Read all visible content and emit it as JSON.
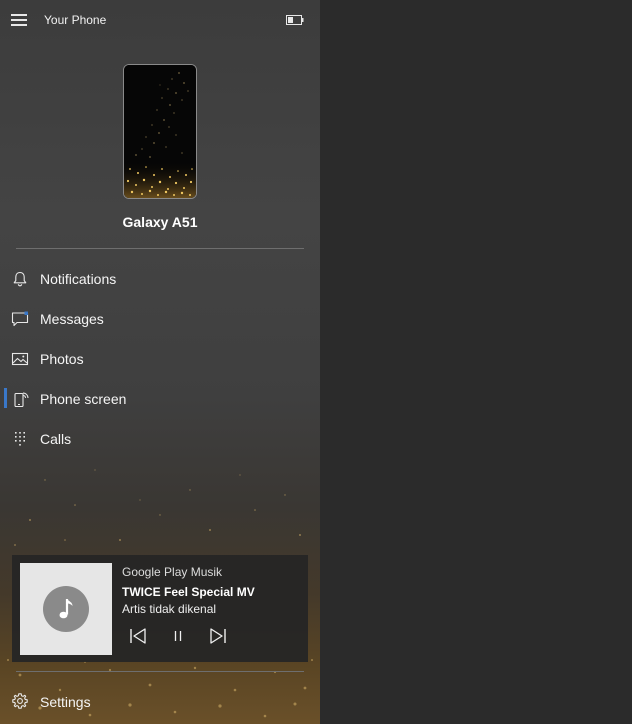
{
  "app": {
    "title": "Your Phone"
  },
  "device": {
    "name": "Galaxy A51"
  },
  "nav": {
    "items": [
      {
        "label": "Notifications",
        "icon": "bell-icon"
      },
      {
        "label": "Messages",
        "icon": "message-icon"
      },
      {
        "label": "Photos",
        "icon": "photo-icon"
      },
      {
        "label": "Phone screen",
        "icon": "phone-screen-icon",
        "active": true
      },
      {
        "label": "Calls",
        "icon": "dialpad-icon"
      }
    ]
  },
  "media": {
    "source": "Google Play Musik",
    "title": "TWICE Feel Special MV",
    "artist": "Artis tidak dikenal",
    "controls": [
      "previous-icon",
      "pause-icon",
      "next-icon"
    ]
  },
  "settings": {
    "label": "Settings",
    "icon": "gear-icon"
  },
  "colors": {
    "accent": "#3a78c9",
    "sidebar_top": "#3c3c3c",
    "sidebar_bottom": "#6a5029",
    "main_bg": "#2b2b2b"
  }
}
